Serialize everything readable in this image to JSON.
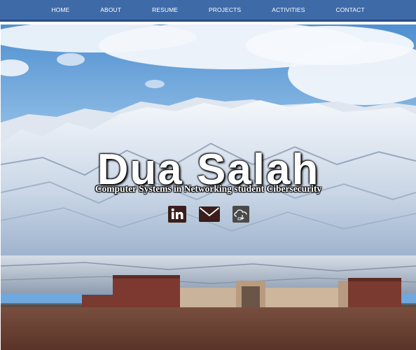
{
  "nav": {
    "items": [
      {
        "label": "HOME",
        "id": "home"
      },
      {
        "label": "ABOUT",
        "id": "about"
      },
      {
        "label": "RESUME",
        "id": "resume"
      },
      {
        "label": "PROJECTS",
        "id": "projects"
      },
      {
        "label": "ACTIVITIES",
        "id": "activities"
      },
      {
        "label": "CONTACT",
        "id": "contact"
      }
    ],
    "background": "#3f6aa8"
  },
  "hero": {
    "title": "Dua Salah",
    "subtitle": "Computer Systems in Networking student Cibersecurity"
  },
  "social": {
    "links": [
      {
        "name": "linkedin",
        "icon": "linkedin-icon"
      },
      {
        "name": "email",
        "icon": "envelope-icon"
      },
      {
        "name": "cloud",
        "icon": "cloud-icon"
      }
    ]
  }
}
